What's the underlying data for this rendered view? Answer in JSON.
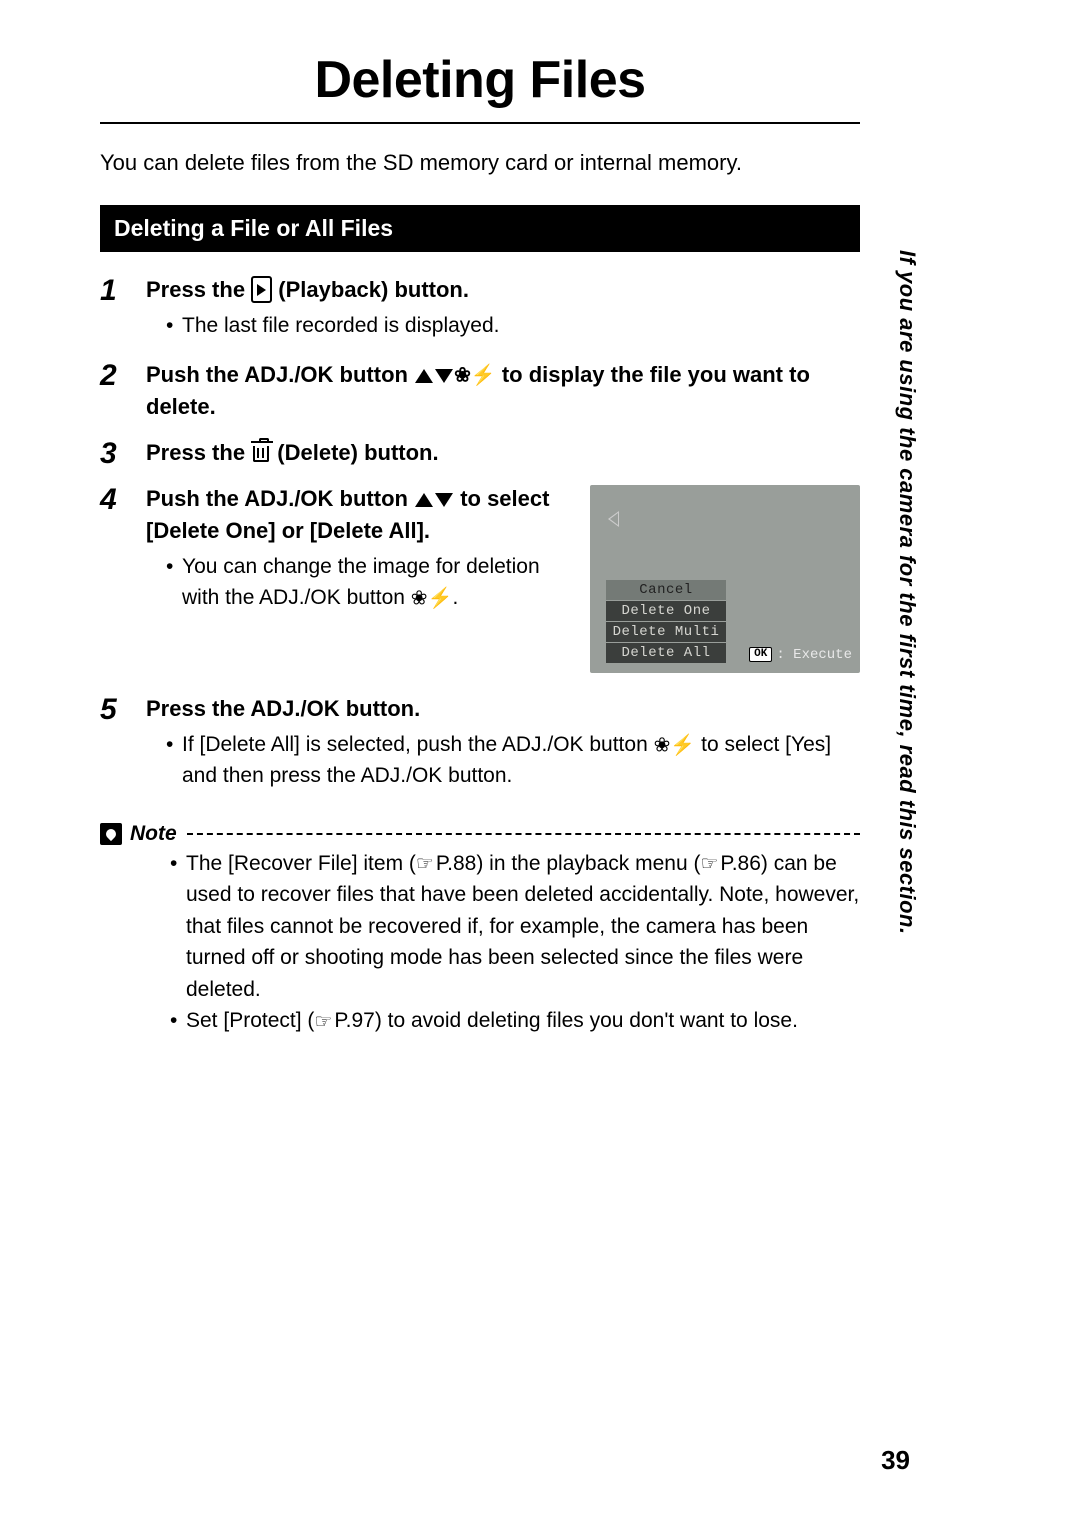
{
  "title": "Deleting Files",
  "intro": "You can delete files from the SD memory card or internal memory.",
  "section_heading": "Deleting a File or All Files",
  "side_text": "If you are using the camera for the first time, read this section.",
  "page_number": "39",
  "steps": [
    {
      "num": "1",
      "title_pre": "Press the ",
      "title_post": " (Playback) button.",
      "bullets": [
        "The last file recorded is displayed."
      ]
    },
    {
      "num": "2",
      "title_pre": "Push the ADJ./OK button ",
      "title_post": " to display the file you want to delete."
    },
    {
      "num": "3",
      "title_pre": "Press the ",
      "title_post": " (Delete) button."
    },
    {
      "num": "4",
      "title_pre": "Push the ADJ./OK button ",
      "title_post": " to select [Delete One] or [Delete All].",
      "bullet_pre": "You can change the image for deletion with the ADJ./OK button ",
      "bullet_post": "."
    },
    {
      "num": "5",
      "title": "Press the ADJ./OK button.",
      "bullet_pre": "If [Delete All] is selected, push the ADJ./OK button ",
      "bullet_post": " to select [Yes] and then press the ADJ./OK button."
    }
  ],
  "lcd_menu": {
    "items": [
      "Cancel",
      "Delete One",
      "Delete Multi",
      "Delete All"
    ],
    "execute_label": ": Execute",
    "ok_label": "OK"
  },
  "note": {
    "label": "Note",
    "items": [
      {
        "pre": "The [Recover File] item (",
        "ref1": "P.88",
        "mid": ") in the playback menu (",
        "ref2": "P.86",
        "post": ") can be used to recover files that have been deleted accidentally.  Note, however, that files cannot be recovered if, for example, the camera has been turned off or shooting mode has been selected since the files were deleted."
      },
      {
        "pre": "Set [Protect] (",
        "ref1": "P.97",
        "post": ") to avoid deleting files you don't want to lose."
      }
    ]
  }
}
